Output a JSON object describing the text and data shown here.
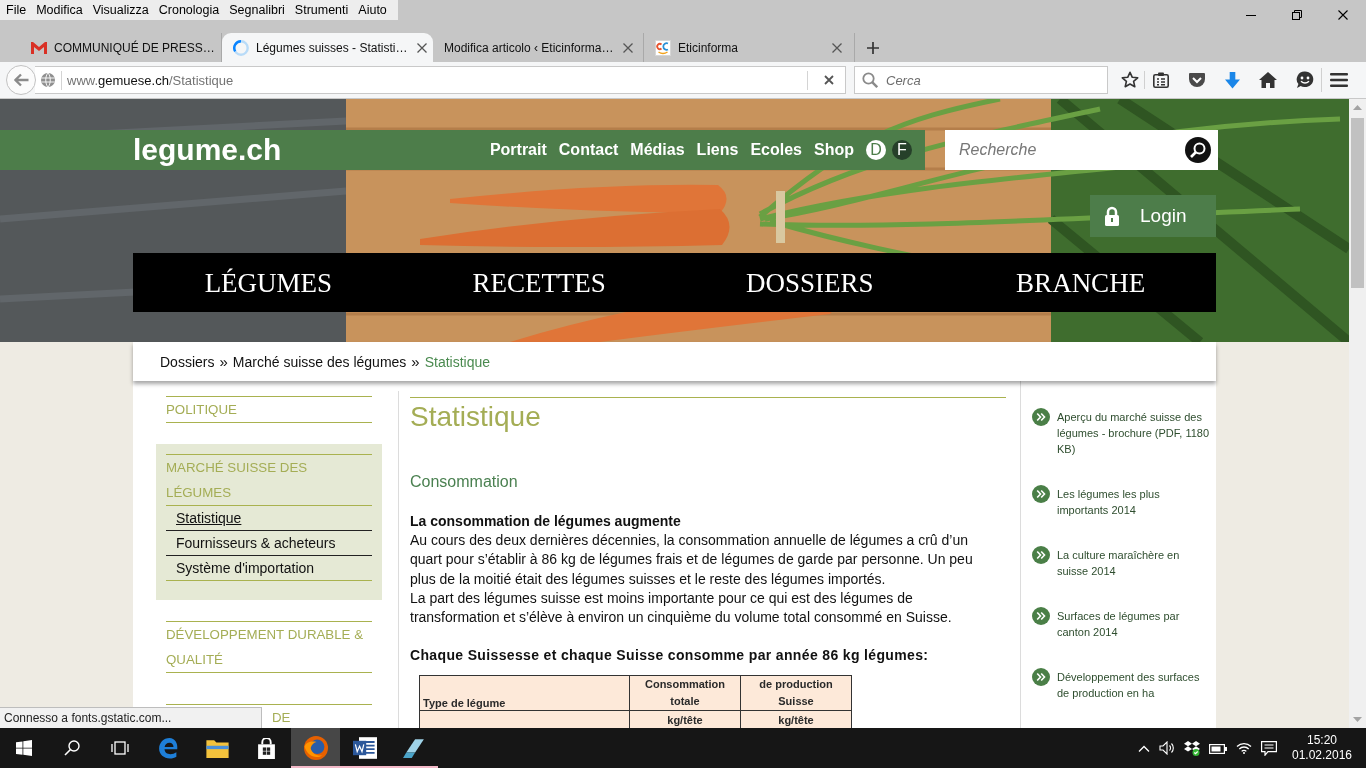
{
  "browser": {
    "menu_bar": [
      "File",
      "Modifica",
      "Visualizza",
      "Cronologia",
      "Segnalibri",
      "Strumenti",
      "Aiuto"
    ],
    "tabs": [
      {
        "title": "COMMUNIQUÉ DE PRESS…",
        "kind": "mail",
        "selected": false
      },
      {
        "title": "Légumes suisses - Statisti…",
        "kind": "loading",
        "selected": true
      },
      {
        "title": "Modifica articolo ‹ Eticinforma…",
        "kind": "plain",
        "selected": false
      },
      {
        "title": "Eticinforma",
        "kind": "site",
        "selected": false
      }
    ],
    "address": {
      "prefix": "www.",
      "domain": "gemuese.ch",
      "path": "/Statistique"
    },
    "search": {
      "placeholder": "Cerca"
    }
  },
  "site": {
    "logo": "legume.ch",
    "top_links": [
      "Portrait",
      "Contact",
      "Médias",
      "Liens",
      "Ecoles",
      "Shop"
    ],
    "languages": [
      {
        "label": "D",
        "selected": false
      },
      {
        "label": "F",
        "selected": true
      }
    ],
    "search": {
      "placeholder": "Recherche"
    },
    "login": "Login",
    "main_nav": [
      "LÉGUMES",
      "RECETTES",
      "DOSSIERS",
      "BRANCHE"
    ],
    "breadcrumb": [
      {
        "kind": "link",
        "text": "Dossiers"
      },
      {
        "kind": "separator",
        "text": "»"
      },
      {
        "kind": "link",
        "text": "Marché suisse des légumes"
      },
      {
        "kind": "separator",
        "text": "»"
      },
      {
        "kind": "current",
        "text": "Statistique"
      }
    ],
    "sidebar": [
      {
        "label": "POLITIQUE",
        "expanded": false
      },
      {
        "label": "MARCHÉ SUISSE DES LÉGUMES",
        "expanded": true,
        "children": [
          {
            "label": "Statistique",
            "selected": true
          },
          {
            "label": "Fournisseurs & acheteurs",
            "selected": false
          },
          {
            "label": "Système d'importation",
            "selected": false
          }
        ]
      },
      {
        "label": "DÉVELOPPEMENT DURABLE & QUALITÉ",
        "expanded": false
      },
      {
        "label": "DE",
        "expanded": false
      }
    ],
    "content": {
      "title": "Statistique",
      "section": "Consommation",
      "heading": "La consommation de légumes augmente",
      "paragraphs": [
        "Au cours des deux dernières décennies, la consommation annuelle de légumes a crû d’un quart pour s’établir à 86 kg de légumes frais et de légumes de garde par personne. Un peu plus de la moitié était des légumes suisses et le reste des légumes importés.",
        "La part des légumes suisse est moins importante pour ce qui est des légumes de transformation et s’élève à environ un cinquième du volume total consommé en Suisse."
      ],
      "table_caption": "Chaque Suissesse et chaque Suisse consomme par année 86 kg légumes:",
      "table": {
        "columns": [
          "Type de légume",
          "Consommation totale",
          "de production Suisse"
        ],
        "unit_row": [
          "kg/tête",
          "kg/tête"
        ]
      }
    },
    "related_links": [
      "Aperçu du marché suisse des légumes - brochure (PDF, 1180 KB)",
      "Les légumes les plus importants 2014",
      "La culture maraîchère en suisse 2014",
      "Surfaces de légumes par canton 2014",
      "Développement des surfaces de production en ha"
    ]
  },
  "status_bar": "Connesso a fonts.gstatic.com...",
  "taskbar": {
    "apps": [
      {
        "open": false,
        "active": false
      },
      {
        "open": false,
        "active": false
      },
      {
        "open": false,
        "active": false
      },
      {
        "open": true,
        "active": true
      },
      {
        "open": true,
        "active": false
      },
      {
        "open": true,
        "active": false
      }
    ],
    "time": "15:20",
    "date": "01.02.2016"
  }
}
